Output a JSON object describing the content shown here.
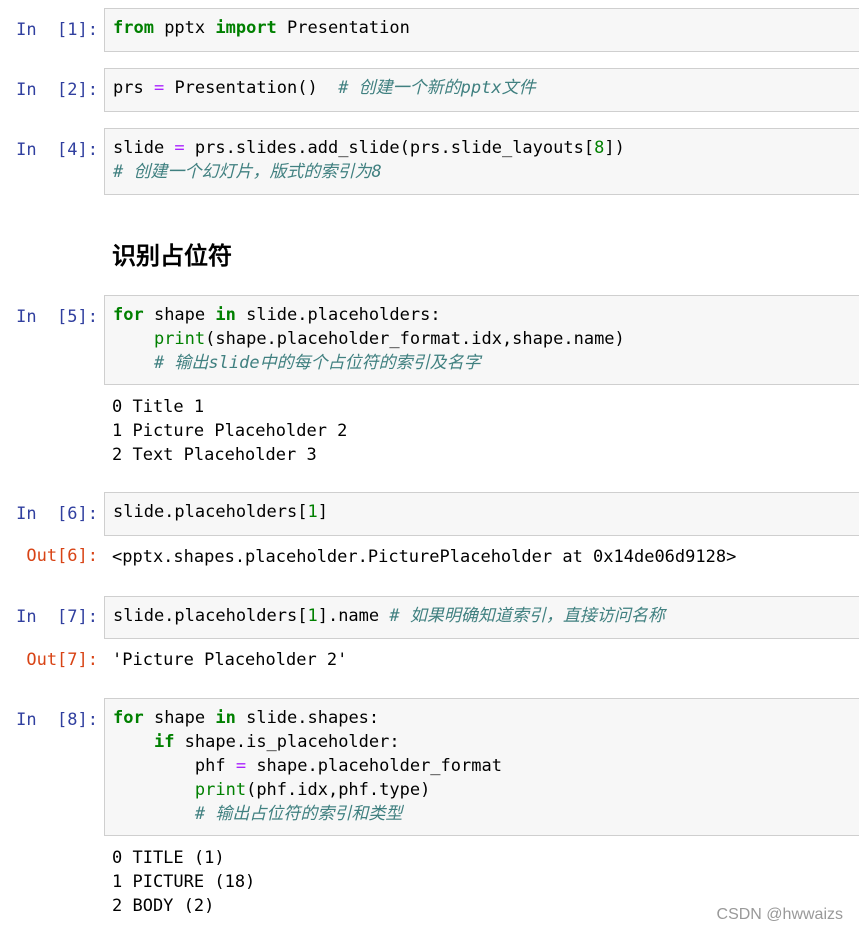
{
  "cells": {
    "c1": {
      "prompt": "In  [1]:",
      "code": [
        [
          {
            "t": "kw",
            "v": "from"
          },
          {
            "t": "",
            "v": " pptx "
          },
          {
            "t": "kw",
            "v": "import"
          },
          {
            "t": "",
            "v": " Presentation"
          }
        ]
      ]
    },
    "c2": {
      "prompt": "In  [2]:",
      "code": [
        [
          {
            "t": "",
            "v": "prs "
          },
          {
            "t": "op",
            "v": "="
          },
          {
            "t": "",
            "v": " Presentation()  "
          },
          {
            "t": "cm",
            "v": "# 创建一个新的pptx文件"
          }
        ]
      ]
    },
    "c3": {
      "prompt": "In  [4]:",
      "code": [
        [
          {
            "t": "",
            "v": "slide "
          },
          {
            "t": "op",
            "v": "="
          },
          {
            "t": "",
            "v": " prs.slides.add_slide(prs.slide_layouts["
          },
          {
            "t": "num",
            "v": "8"
          },
          {
            "t": "",
            "v": "])"
          }
        ],
        [
          {
            "t": "cm",
            "v": "# 创建一个幻灯片，版式的索引为8"
          }
        ]
      ]
    },
    "heading": "识别占位符",
    "c4": {
      "prompt": "In  [5]:",
      "code": [
        [
          {
            "t": "kw",
            "v": "for"
          },
          {
            "t": "",
            "v": " shape "
          },
          {
            "t": "kw",
            "v": "in"
          },
          {
            "t": "",
            "v": " slide.placeholders:"
          }
        ],
        [
          {
            "t": "",
            "v": "    "
          },
          {
            "t": "bi",
            "v": "print"
          },
          {
            "t": "",
            "v": "(shape.placeholder_format.idx,shape.name)"
          }
        ],
        [
          {
            "t": "",
            "v": "    "
          },
          {
            "t": "cm",
            "v": "# 输出slide中的每个占位符的索引及名字"
          }
        ]
      ],
      "output": [
        "0 Title 1",
        "1 Picture Placeholder 2",
        "2 Text Placeholder 3"
      ]
    },
    "c5": {
      "prompt": "In  [6]:",
      "code": [
        [
          {
            "t": "",
            "v": "slide.placeholders["
          },
          {
            "t": "num",
            "v": "1"
          },
          {
            "t": "",
            "v": "]"
          }
        ]
      ],
      "out_prompt": "Out[6]:",
      "output": [
        "<pptx.shapes.placeholder.PicturePlaceholder at 0x14de06d9128>"
      ]
    },
    "c6": {
      "prompt": "In  [7]:",
      "code": [
        [
          {
            "t": "",
            "v": "slide.placeholders["
          },
          {
            "t": "num",
            "v": "1"
          },
          {
            "t": "",
            "v": "].name "
          },
          {
            "t": "cm",
            "v": "# 如果明确知道索引，直接访问名称"
          }
        ]
      ],
      "out_prompt": "Out[7]:",
      "output": [
        "'Picture Placeholder 2'"
      ]
    },
    "c7": {
      "prompt": "In  [8]:",
      "code": [
        [
          {
            "t": "kw",
            "v": "for"
          },
          {
            "t": "",
            "v": " shape "
          },
          {
            "t": "kw",
            "v": "in"
          },
          {
            "t": "",
            "v": " slide.shapes:"
          }
        ],
        [
          {
            "t": "",
            "v": "    "
          },
          {
            "t": "kw",
            "v": "if"
          },
          {
            "t": "",
            "v": " shape.is_placeholder:"
          }
        ],
        [
          {
            "t": "",
            "v": "        phf "
          },
          {
            "t": "op",
            "v": "="
          },
          {
            "t": "",
            "v": " shape.placeholder_format"
          }
        ],
        [
          {
            "t": "",
            "v": "        "
          },
          {
            "t": "bi",
            "v": "print"
          },
          {
            "t": "",
            "v": "(phf.idx,phf.type)"
          }
        ],
        [
          {
            "t": "",
            "v": "        "
          },
          {
            "t": "cm",
            "v": "# 输出占位符的索引和类型"
          }
        ]
      ],
      "output": [
        "0 TITLE (1)",
        "1 PICTURE (18)",
        "2 BODY (2)"
      ]
    }
  },
  "watermark": "CSDN @hwwaizs",
  "colors": {
    "prompt_in": "#303f9f",
    "prompt_out": "#d84315",
    "keyword": "#008000",
    "comment": "#408080",
    "operator": "#aa22ff",
    "cell_bg": "#f7f7f7",
    "cell_border": "#cfcfcf"
  }
}
